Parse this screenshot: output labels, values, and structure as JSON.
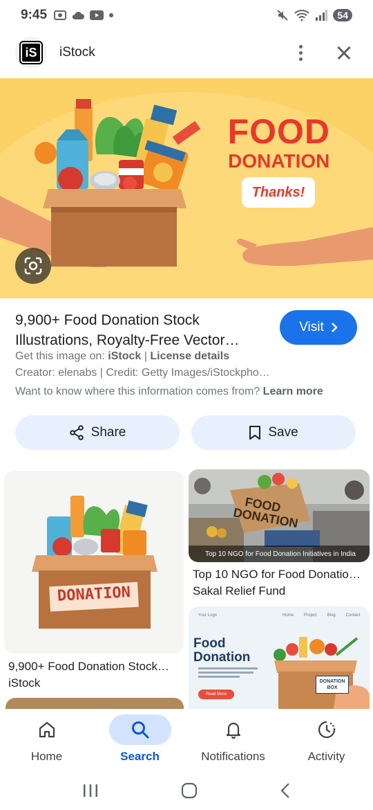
{
  "status_bar": {
    "time": "9:45",
    "battery": "54"
  },
  "header": {
    "site_name": "iStock",
    "logo_text": "iS"
  },
  "hero": {
    "title_line1": "FOOD",
    "title_line2": "DONATION",
    "bubble": "Thanks!"
  },
  "result": {
    "title": "9,900+ Food Donation Stock Illustrations, Royalty-Free Vector…",
    "visit_label": "Visit",
    "get_image_prefix": "Get this image on:",
    "get_image_source": "iStock",
    "license_label": "License details",
    "credit_line": "Creator: elenabs | Credit: Getty Images/iStockpho…",
    "info_question": "Want to know where this information comes from?",
    "learn_more": "Learn more"
  },
  "actions": {
    "share_label": "Share",
    "save_label": "Save"
  },
  "related": [
    {
      "title": "9,900+ Food Donation Stock…",
      "source": "iStock",
      "box_label": "DONATION"
    },
    {
      "title": "Top 10 NGO for Food Donatio…",
      "source": "Sakal Relief Fund",
      "overlay": "Top 10 NGO for Food Donation Initiatives in India",
      "box_label": "FOOD DONATION"
    },
    {
      "headline": "Food Donation",
      "box_label": "DONATION BOX",
      "button": "Read More",
      "logo": "Your Logo",
      "nav": [
        "Home",
        "Project",
        "Blog",
        "Contact"
      ]
    }
  ],
  "bottom_nav": {
    "items": [
      {
        "label": "Home",
        "icon": "home-icon"
      },
      {
        "label": "Search",
        "icon": "search-icon",
        "active": true
      },
      {
        "label": "Notifications",
        "icon": "bell-icon"
      },
      {
        "label": "Activity",
        "icon": "activity-icon"
      }
    ]
  },
  "colors": {
    "accent": "#1a73e8",
    "hero_bg": "#fcd166",
    "hero_text": "#e8382a",
    "pill_bg": "#e8f0fe",
    "active_nav": "#0b57d0"
  }
}
